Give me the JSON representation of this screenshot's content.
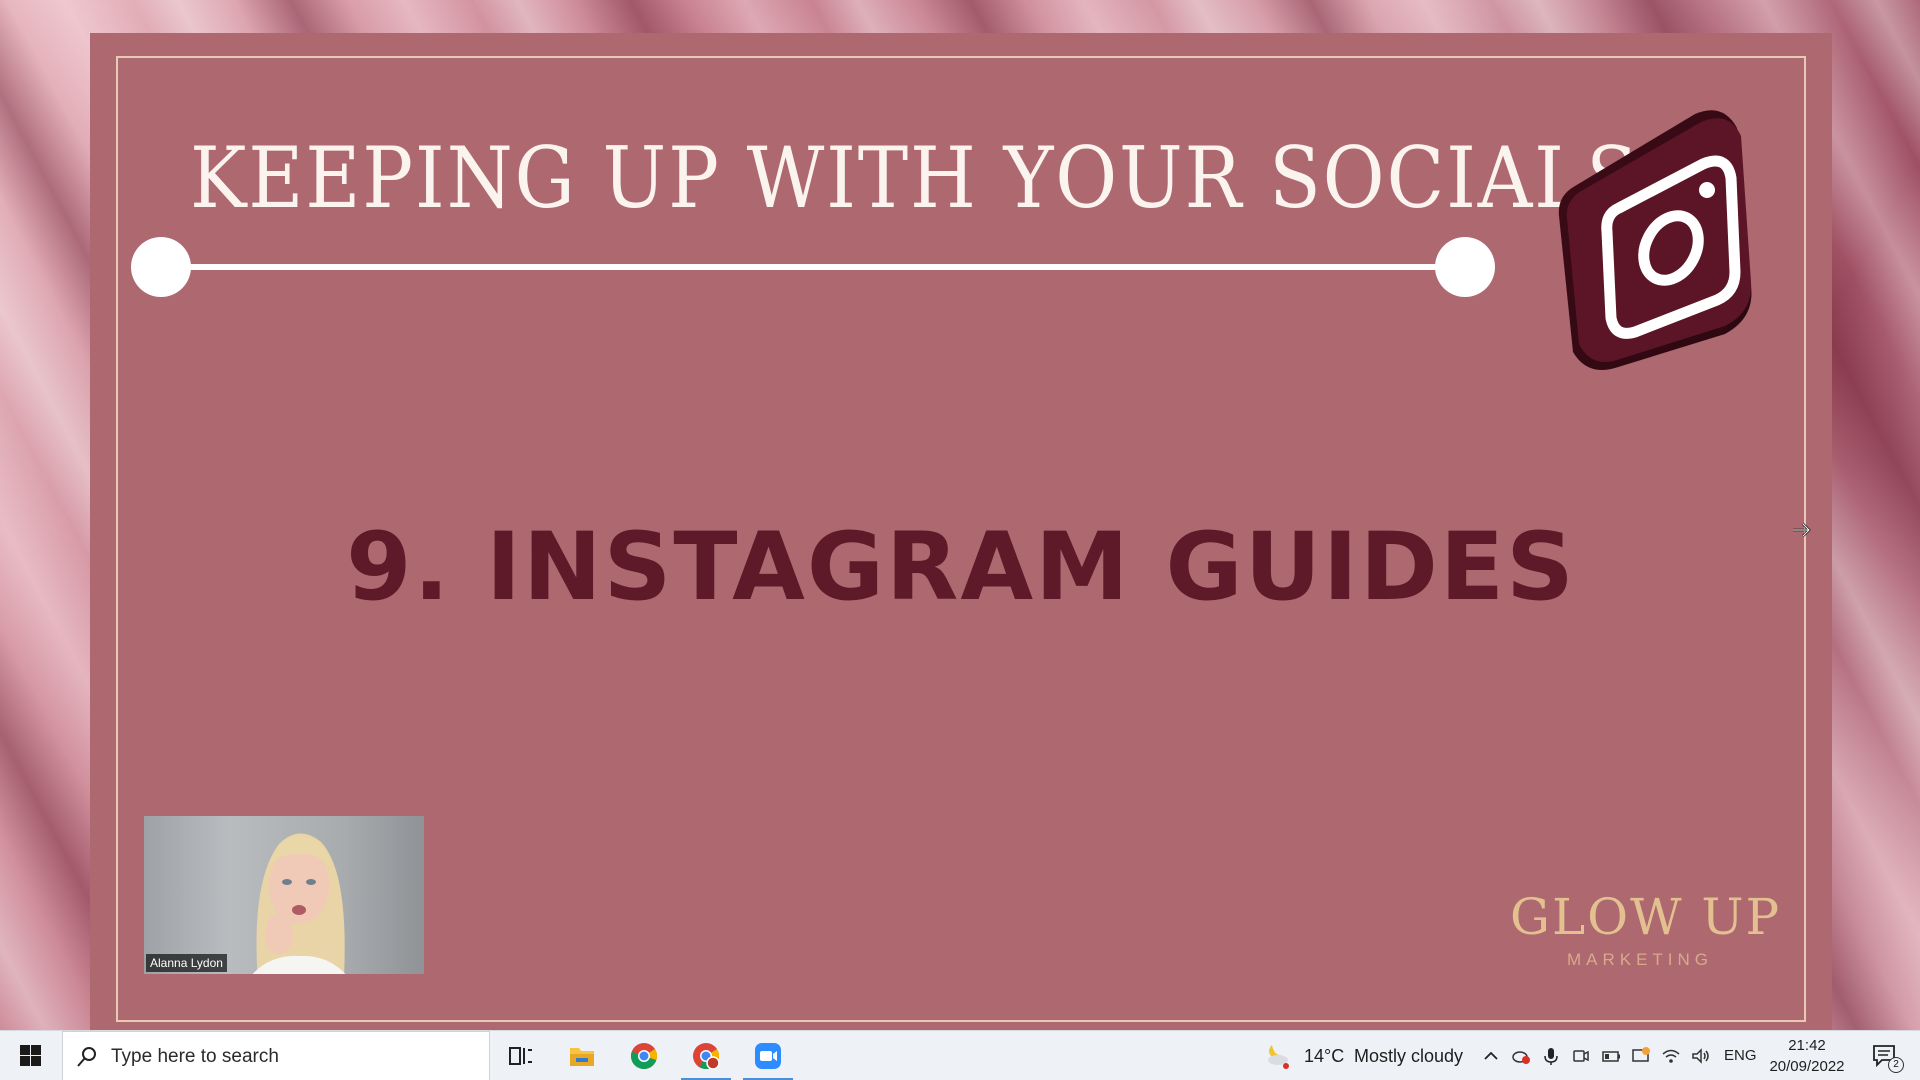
{
  "slide": {
    "title": "KEEPING UP WITH YOUR SOCIALS",
    "heading": "9. INSTAGRAM GUIDES",
    "brand_name": "GLOW UP",
    "brand_sub": "MARKETING",
    "logo_icon": "instagram-icon",
    "colors": {
      "slide_bg": "#ad6870",
      "heading": "#5e1a28",
      "logo_bg": "#5b1526",
      "brand_gold": "#e3c08f"
    }
  },
  "video": {
    "participant_name": "Alanna Lydon"
  },
  "taskbar": {
    "search_placeholder": "Type here to search",
    "apps": [
      "task-view-icon",
      "file-explorer-icon",
      "chrome-icon",
      "chrome-profile-icon",
      "zoom-icon"
    ],
    "weather": {
      "temp": "14°C",
      "desc": "Mostly cloudy"
    },
    "language": "ENG",
    "time": "21:42",
    "date": "20/09/2022",
    "notifications": "2"
  }
}
